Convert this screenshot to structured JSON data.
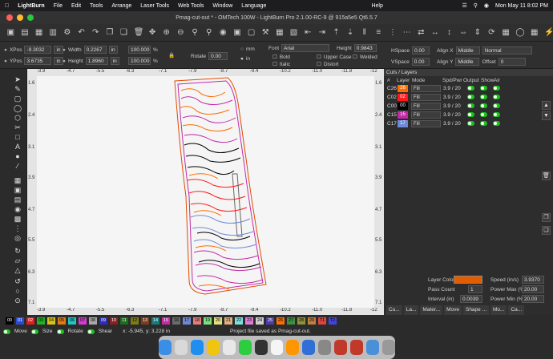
{
  "menubar": {
    "app_name": "LightBurn",
    "items": [
      "File",
      "Edit",
      "Tools",
      "Arrange",
      "Laser Tools",
      "Web Tools",
      "Window",
      "Language",
      "Help"
    ],
    "clock": "Mon May 11  8:02 PM"
  },
  "window": {
    "title": "Pmag-cut-out * - OMTech 100W - LightBurn Pro 2.1.00-RC-9 @ 915a5e5 Qt6.5.7"
  },
  "numeric": {
    "xpos_label": "XPos",
    "xpos_value": "-9.3032",
    "xpos_unit": "in",
    "ypos_label": "YPos",
    "ypos_value": "3.6735",
    "ypos_unit": "in",
    "width_label": "Width",
    "width_value": "0.2267",
    "width_unit": "in",
    "height_label": "Height",
    "height_value": "1.8960",
    "height_unit": "in",
    "scale_w": "100.000",
    "scale_h": "100.000",
    "pct": "%",
    "rotate_label": "Rotate",
    "rotate_value": "0.00",
    "unit_mm": "mm",
    "unit_in": "in"
  },
  "text_tools": {
    "font_label": "Font",
    "font_value": "Arial",
    "bold": "Bold",
    "italic": "Italic",
    "upper_case": "Upper Case",
    "welded": "Welded",
    "distort": "Distort",
    "height_label": "Height",
    "height_value": "0.9843",
    "hspace_label": "HSpace",
    "hspace_value": "0.00",
    "vspace_label": "VSpace",
    "vspace_value": "0.00",
    "alignx_label": "Align X",
    "alignx_value": "Middle",
    "aligny_label": "Align Y",
    "aligny_value": "Middle",
    "normal_value": "Normal",
    "offset_label": "Offset",
    "offset_value": "0"
  },
  "ruler": {
    "top": [
      "-3.9",
      "-4.7",
      "-5.5",
      "-6.3",
      "-7.1",
      "-7.9",
      "-8.7",
      "-9.4",
      "-10.2",
      "-11.0",
      "-11.8",
      "-12"
    ],
    "bottom": [
      "-3.9",
      "-4.7",
      "-5.5",
      "-6.3",
      "-7.1",
      "-7.9",
      "-8.7",
      "-9.4",
      "-10.2",
      "-11.0",
      "-11.8",
      "-12"
    ],
    "left": [
      "1.6",
      "2.4",
      "3.1",
      "3.9",
      "4.7",
      "5.5",
      "6.3",
      "7.1"
    ],
    "right": [
      "1.6",
      "2.4",
      "3.1",
      "3.9",
      "4.7",
      "5.5",
      "6.3",
      "7.1"
    ]
  },
  "cuts_panel": {
    "title": "Cuts / Layers",
    "headers": [
      "#",
      "Layer",
      "Mode",
      "Spd/Pwr",
      "Output",
      "Show",
      "Air"
    ],
    "rows": [
      {
        "num": "C26",
        "layer": "26",
        "color": "#ff6c00",
        "mode": "Fill",
        "spdpwr": "3.9 / 20"
      },
      {
        "num": "C02",
        "layer": "02",
        "color": "#ff1a1a",
        "mode": "Fill",
        "spdpwr": "3.9 / 20"
      },
      {
        "num": "C00",
        "layer": "00",
        "color": "#000000",
        "mode": "Fill",
        "spdpwr": "3.9 / 20"
      },
      {
        "num": "C15",
        "layer": "15",
        "color": "#c22aa6",
        "mode": "Fill",
        "spdpwr": "3.9 / 20"
      },
      {
        "num": "C17",
        "layer": "17",
        "color": "#6e8ad6",
        "mode": "Fill",
        "spdpwr": "3.9 / 20"
      }
    ]
  },
  "layer_settings": {
    "layer_color_label": "Layer Color",
    "layer_color": "#e25c00",
    "speed_label": "Speed (in/s)",
    "speed_value": "3.9370",
    "pass_label": "Pass Count",
    "pass_value": "1",
    "powermax_label": "Power Max (%)",
    "powermax_value": "20.00",
    "interval_label": "Interval (in)",
    "interval_value": "0.0039",
    "powermin_label": "Power Min (%)",
    "powermin_value": "20.00"
  },
  "panel_tabs": [
    "Cu...",
    "La...",
    "Mater...",
    "Move",
    "Shape ...",
    "Mo...",
    "Ca..."
  ],
  "palette": [
    {
      "label": "00",
      "color": "#000000"
    },
    {
      "label": "01",
      "color": "#2a4bd4"
    },
    {
      "label": "02",
      "color": "#e21c1c"
    },
    {
      "label": "03",
      "color": "#1fb41f"
    },
    {
      "label": "04",
      "color": "#d7c31e"
    },
    {
      "label": "05",
      "color": "#e07a16"
    },
    {
      "label": "06",
      "color": "#20c4c4"
    },
    {
      "label": "07",
      "color": "#d13bd1"
    },
    {
      "label": "08",
      "color": "#a8a8a8"
    },
    {
      "label": "09",
      "color": "#2d2db8"
    },
    {
      "label": "10",
      "color": "#8a1f1f"
    },
    {
      "label": "11",
      "color": "#1d6d1d"
    },
    {
      "label": "12",
      "color": "#7b7b18"
    },
    {
      "label": "13",
      "color": "#7a3e1a"
    },
    {
      "label": "14",
      "color": "#1b7a7a"
    },
    {
      "label": "15",
      "color": "#c22aa6"
    },
    {
      "label": "16",
      "color": "#6a6a6a"
    },
    {
      "label": "17",
      "color": "#6e8ad6"
    },
    {
      "label": "18",
      "color": "#e37e7e"
    },
    {
      "label": "19",
      "color": "#7ee07e"
    },
    {
      "label": "20",
      "color": "#e0e07e"
    },
    {
      "label": "21",
      "color": "#e0b07e"
    },
    {
      "label": "22",
      "color": "#7ee0e0"
    },
    {
      "label": "23",
      "color": "#e07ee0"
    },
    {
      "label": "24",
      "color": "#cfcfcf"
    },
    {
      "label": "25",
      "color": "#4b3db0"
    },
    {
      "label": "26",
      "color": "#ff6c00"
    },
    {
      "label": "27",
      "color": "#3f8f3f"
    },
    {
      "label": "28",
      "color": "#8f8f3f"
    },
    {
      "label": "29",
      "color": "#bf7f3f"
    },
    {
      "label": "T1",
      "color": "#d44"
    },
    {
      "label": "T2",
      "color": "#44d"
    }
  ],
  "statusbar": {
    "move": "Move",
    "size": "Size",
    "rotate": "Rotate",
    "shear": "Shear",
    "coords": "x: -5.945, y: 3.228 in",
    "message": "Project file saved as Pmag-cut-out."
  }
}
